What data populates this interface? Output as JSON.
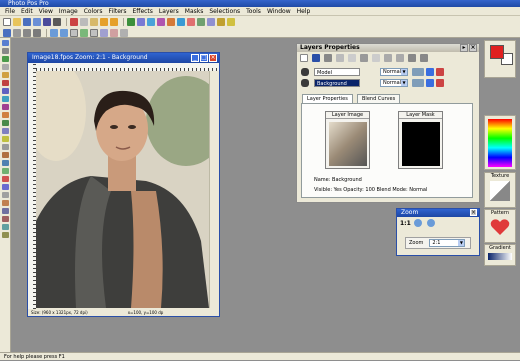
{
  "app": {
    "title": "Photo Pos Pro"
  },
  "menu": [
    "File",
    "Edit",
    "View",
    "Image",
    "Colors",
    "Filters",
    "Effects",
    "Layers",
    "Masks",
    "Selections",
    "Tools",
    "Window",
    "Help"
  ],
  "status_text": "For help please press F1",
  "image_window": {
    "title": "Image18.fpos  Zoom: 2:1 - Background",
    "status_size": "Size: (960 x 1321px, 72 dpi)",
    "status_coords": "x=100, y=100 dp"
  },
  "layers_panel": {
    "title": "Layers Properties",
    "layers": [
      {
        "name": "Model",
        "mode": "Normal",
        "selected": false
      },
      {
        "name": "Background",
        "mode": "Normal",
        "selected": true
      }
    ],
    "tabs": [
      "Layer Properties",
      "Blend Curves"
    ],
    "layer_image_label": "Layer Image",
    "layer_mask_label": "Layer Mask",
    "name_line": "Name: Background",
    "info_line": "Visible: Yes   Opacity: 100   Blend Mode: Normal"
  },
  "zoom_panel": {
    "title": "Zoom",
    "ratio_label": "1:1",
    "zoom_label": "Zoom",
    "zoom_value": "2:1"
  },
  "right_panel": {
    "texture_label": "Texture",
    "pattern_label": "Pattern",
    "gradient_label": "Gradient"
  },
  "colors": {
    "title_blue": "#2f63d0",
    "fg_color": "#e02020",
    "bg_color": "#ffffff"
  }
}
